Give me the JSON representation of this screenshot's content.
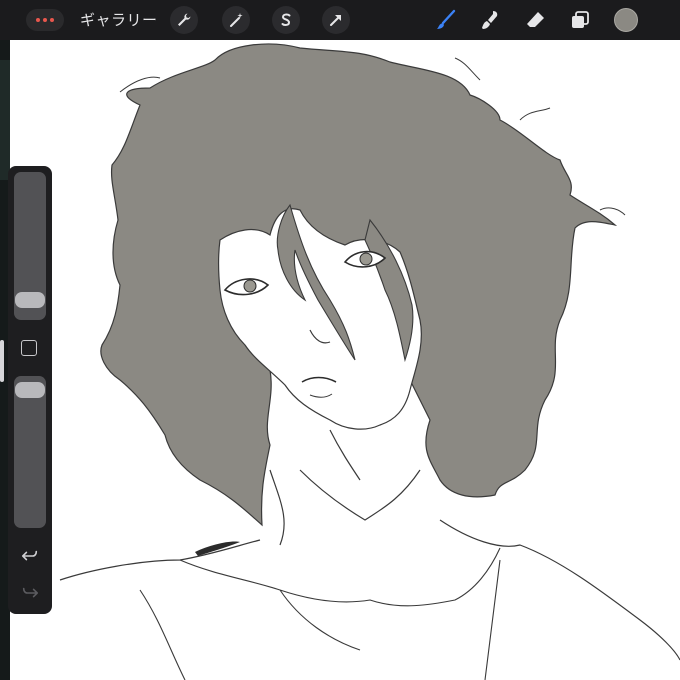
{
  "toolbar": {
    "gallery_label": "ギャラリー",
    "left_tools": [
      "wrench-icon",
      "magic-wand-icon",
      "selection-s-icon",
      "transform-arrow-icon"
    ],
    "right_tools": [
      "brush-icon",
      "smudge-icon",
      "eraser-icon",
      "layers-icon"
    ],
    "active_tool": "brush-icon",
    "accent_color": "#3b82f6",
    "current_color": "#8b8983"
  },
  "sidebar": {
    "size_slider_level": 0.77,
    "opacity_slider_level": 0.05,
    "controls": [
      "modify-button",
      "undo-button",
      "redo-button"
    ]
  },
  "canvas": {
    "hair_color": "#8b8983",
    "line_color": "#3a3a3a"
  }
}
